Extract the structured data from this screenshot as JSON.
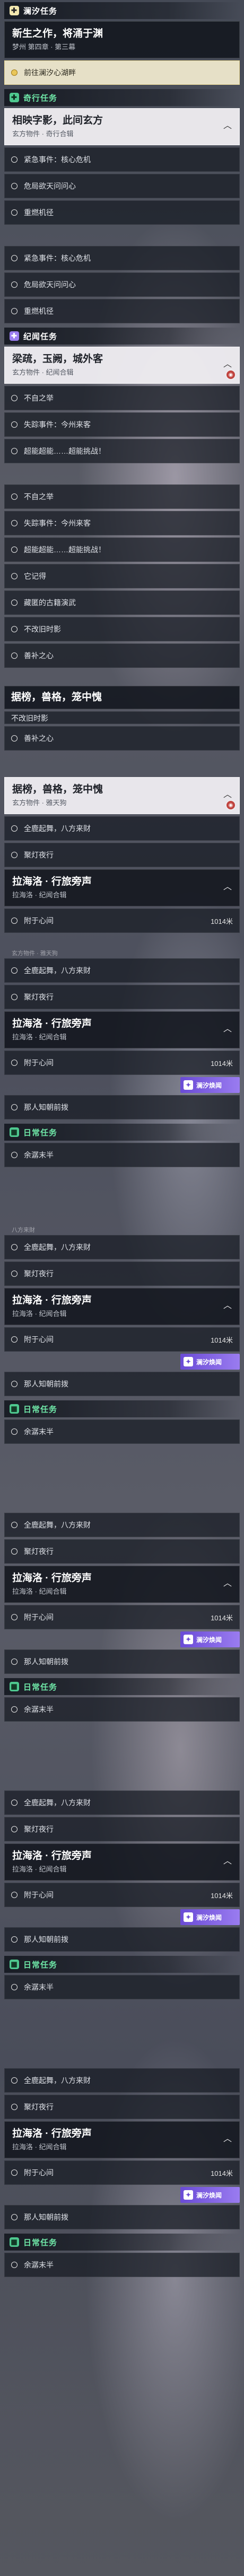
{
  "colors": {
    "main_badge": "#f3e8b0",
    "purple": "#9b7ef0",
    "green": "#4ec88f",
    "selected": "#e9c659",
    "pin": "#c0443f"
  },
  "icons": {
    "main_badge": "plus-icon",
    "purple_badge": "plus-icon",
    "green_badge": "calendar-icon",
    "pin": "map-pin-icon",
    "row": "circle-icon",
    "tag": "quest-tag-icon",
    "chev": "chevron-icon"
  },
  "s1": {
    "header": "澜汐任务",
    "card": {
      "title": "新生之作，将涌于渊",
      "sub": "梦州 第四章 · 第三幕"
    },
    "selected": "前往澜汐心湖畔"
  },
  "s2": {
    "header": "奇行任务",
    "card": {
      "title": "相映字影，此间玄方",
      "sub": "玄方物件 · 奇行合辑"
    },
    "rows": [
      "紧急事件：核心危机",
      "危局欲天问问心",
      "重燃机径"
    ]
  },
  "s3": {
    "rows": [
      "紧急事件：核心危机",
      "危局欲天问问心",
      "重燃机径"
    ],
    "header": "纪闻任务",
    "card": {
      "title": "梁疏，玉阙，城外客",
      "sub": "玄方物件 · 纪闻合辑"
    },
    "rows2": [
      "不自之举",
      "失踪事件：今州来客",
      "超能超能……超能挑战！"
    ]
  },
  "s4": {
    "rows": [
      "不自之举",
      "失踪事件：今州来客",
      "超能超能……超能挑战！",
      "它记得",
      "藏匿的古籍演武",
      "不改旧时影",
      "善补之心"
    ],
    "card_title": "据榜，兽格，笼中愧",
    "cut": "不改旧时影",
    "rows2": [
      "善补之心"
    ]
  },
  "s5": {
    "card": {
      "title": "据榜，兽格，笼中愧",
      "sub": "玄方物件 · 雅天狗"
    },
    "rows": [
      "全鹿起舞，八方来财",
      "聚灯夜行"
    ],
    "card2": {
      "title": "拉海洛 · 行旅旁声",
      "sub": "拉海洛 · 纪闻合辑"
    },
    "row3": {
      "label": "附于心间",
      "dist": "1014米"
    }
  },
  "s6": {
    "ghost": "玄方物件 · 雅天狗",
    "rows": [
      "全鹿起舞，八方来财",
      "聚灯夜行"
    ],
    "card": {
      "title": "拉海洛 · 行旅旁声",
      "sub": "拉海洛 · 纪闻合辑"
    },
    "dist_row": {
      "label": "附于心间",
      "dist": "1014米"
    },
    "tag": "澜汐焕闻",
    "row_b": "那人知朝前拨",
    "header": "日常任务",
    "daily": "余潺末半"
  },
  "s7": {
    "ghost": "八方来財",
    "rows": [
      "全鹿起舞，八方来财",
      "聚灯夜行"
    ],
    "card": {
      "title": "拉海洛 · 行旅旁声",
      "sub": "拉海洛 · 纪闻合辑"
    },
    "dist_row": {
      "label": "附于心间",
      "dist": "1014米"
    },
    "tag": "澜汐焕闻",
    "row_b": "那人知朝前拨",
    "header": "日常任务",
    "daily": "余潺末半"
  },
  "s8": {
    "rows": [
      "全鹿起舞，八方来财",
      "聚灯夜行"
    ],
    "card": {
      "title": "拉海洛 · 行旅旁声",
      "sub": "拉海洛 · 纪闻合辑"
    },
    "dist_row": {
      "label": "附于心间",
      "dist": "1014米"
    },
    "tag": "澜汐焕闻",
    "row_b": "那人知朝前拨",
    "header": "日常任务",
    "daily": "余潺末半"
  },
  "s9": {
    "rows": [
      "全鹿起舞，八方来财",
      "聚灯夜行"
    ],
    "card": {
      "title": "拉海洛 · 行旅旁声",
      "sub": "拉海洛 · 纪闻合辑"
    },
    "dist_row": {
      "label": "附于心间",
      "dist": "1014米"
    },
    "tag": "澜汐焕闻",
    "row_b": "那人知朝前拨",
    "header": "日常任务",
    "daily": "余潺末半"
  },
  "s10": {
    "rows": [
      "全鹿起舞，八方来财",
      "聚灯夜行"
    ],
    "card": {
      "title": "拉海洛 · 行旅旁声",
      "sub": "拉海洛 · 纪闻合辑"
    },
    "dist_row": {
      "label": "附于心间",
      "dist": "1014米"
    },
    "tag": "澜汐焕闻",
    "row_b": "那人知朝前拨",
    "header": "日常任务",
    "daily": "余潺末半"
  }
}
